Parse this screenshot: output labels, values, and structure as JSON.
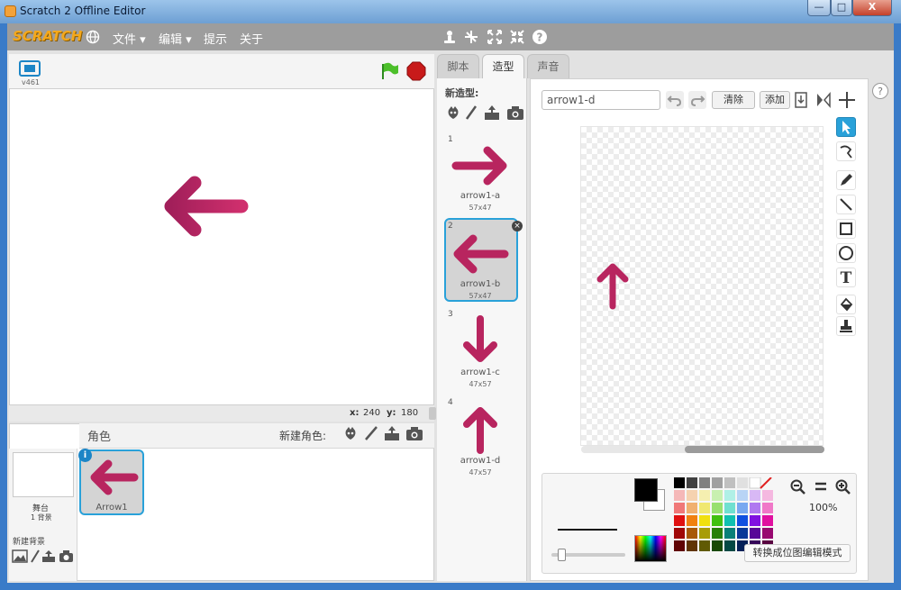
{
  "window": {
    "title": "Scratch 2 Offline Editor",
    "min": "—",
    "max": "□",
    "close": "X"
  },
  "menubar": {
    "logo": "SCRATCH",
    "file": "文件 ▾",
    "edit": "编辑 ▾",
    "tips": "提示",
    "about": "关于"
  },
  "stage": {
    "version": "v461",
    "x_label": "x:",
    "x_value": "240",
    "y_label": "y:",
    "y_value": "180"
  },
  "sprites": {
    "header": "角色",
    "new_sprite": "新建角色:",
    "stage_label": "舞台",
    "backdrop_count": "1 背景",
    "new_backdrop": "新建背景",
    "sprite_name": "Arrow1",
    "info_badge": "i"
  },
  "tabs": {
    "scripts": "脚本",
    "costumes": "造型",
    "sounds": "声音"
  },
  "costumes": {
    "new_costume": "新造型:",
    "items": [
      {
        "num": "1",
        "name": "arrow1-a",
        "size": "57x47"
      },
      {
        "num": "2",
        "name": "arrow1-b",
        "size": "57x47"
      },
      {
        "num": "3",
        "name": "arrow1-c",
        "size": "47x57"
      },
      {
        "num": "4",
        "name": "arrow1-d",
        "size": "47x57"
      }
    ]
  },
  "editor": {
    "costume_name": "arrow1-d",
    "clear_btn": "清除",
    "zoom": "100%",
    "convert_btn": "转换成位图编辑模式",
    "add_btn": "添加"
  },
  "colors": {
    "arrow": "#b8255f",
    "accent": "#29a1d9",
    "menubar": "#9d9d9d"
  }
}
